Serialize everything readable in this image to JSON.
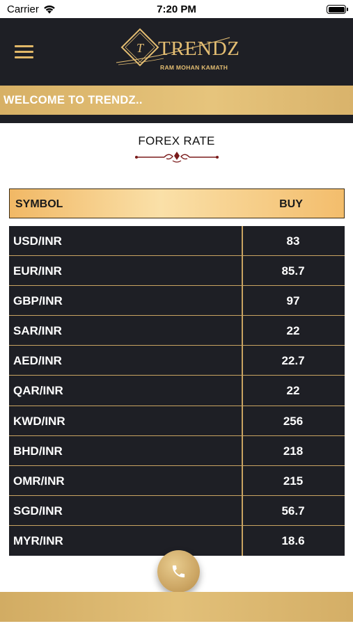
{
  "status_bar": {
    "carrier": "Carrier",
    "time": "7:20 PM"
  },
  "header": {
    "brand": "TRENDZ",
    "brand_sub": "RAM MOHAN KAMATH",
    "logo_mark": "T"
  },
  "welcome": {
    "text": "WELCOME TO TRENDZ.."
  },
  "page": {
    "title": "FOREX RATE"
  },
  "table": {
    "columns": [
      "SYMBOL",
      "BUY"
    ],
    "rows": [
      {
        "symbol": "USD/INR",
        "buy": "83"
      },
      {
        "symbol": "EUR/INR",
        "buy": "85.7"
      },
      {
        "symbol": "GBP/INR",
        "buy": "97"
      },
      {
        "symbol": "SAR/INR",
        "buy": "22"
      },
      {
        "symbol": "AED/INR",
        "buy": "22.7"
      },
      {
        "symbol": "QAR/INR",
        "buy": "22"
      },
      {
        "symbol": "KWD/INR",
        "buy": "256"
      },
      {
        "symbol": "BHD/INR",
        "buy": "218"
      },
      {
        "symbol": "OMR/INR",
        "buy": "215"
      },
      {
        "symbol": "SGD/INR",
        "buy": "56.7"
      },
      {
        "symbol": "MYR/INR",
        "buy": "18.6"
      }
    ]
  },
  "icons": {
    "menu": "hamburger-menu-icon",
    "call": "phone-icon",
    "wifi": "wifi-icon",
    "battery": "battery-icon",
    "ornament": "ornament-divider-icon"
  },
  "colors": {
    "dark": "#1e1f25",
    "gold": "#d7b065",
    "table_border": "#c9a462",
    "header_gradient_light": "#fae0a8"
  }
}
